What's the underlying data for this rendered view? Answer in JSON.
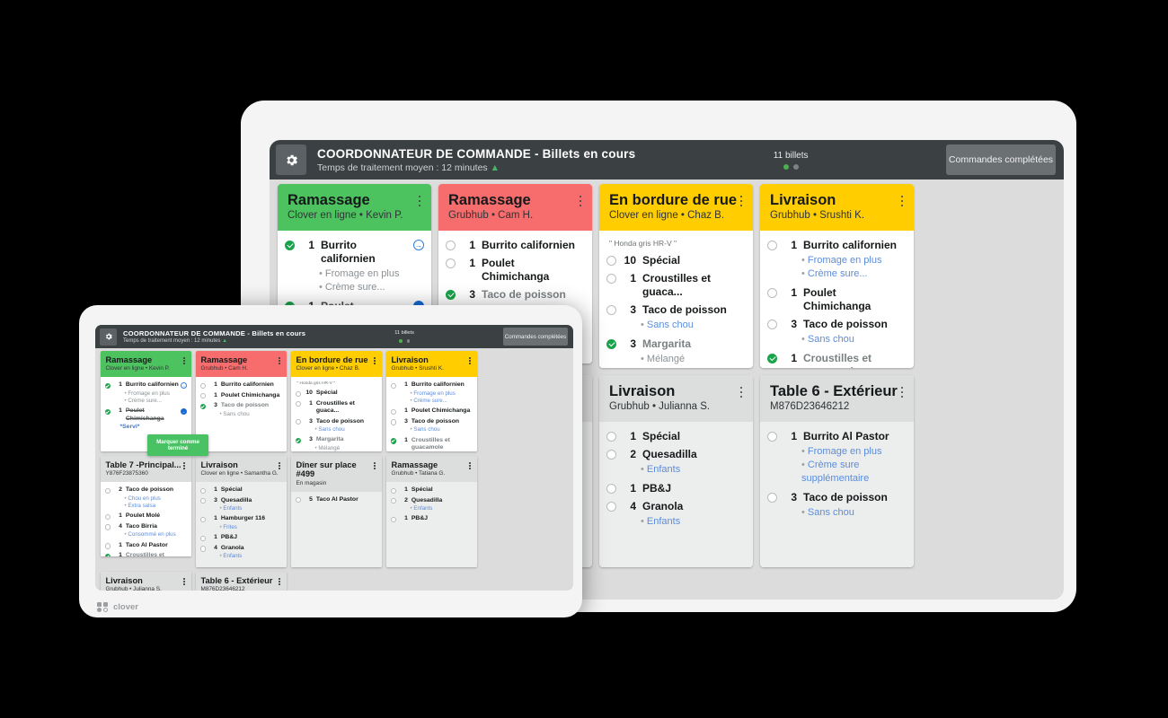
{
  "header": {
    "title": "COORDONNATEUR DE COMMANDE - Billets en cours",
    "subtitle": "Temps de traitement moyen : 12 minutes",
    "subtitle_arrow": "▲",
    "ticket_count": "11 billets",
    "completed_button": "Commandes complétées",
    "gear_icon": "gear-icon"
  },
  "brand": {
    "name": "clover"
  },
  "tooltip": {
    "text": "Marquer comme terminé"
  },
  "colors": {
    "green": "#4cc35f",
    "red": "#f76c6c",
    "yellow": "#ffcd00",
    "gray": "#dcdddd",
    "header_bg": "#3b4043",
    "accent_blue": "#5b8ddb",
    "done_green": "#1aa34a"
  },
  "tickets": [
    {
      "title": "Ramassage",
      "subtitle": "Clover en ligne •  Kevin P.",
      "color": "#4cc35f",
      "variant": "color",
      "note": "",
      "items": [
        {
          "done": true,
          "qty": "1",
          "name": "Burrito californien",
          "arrow": "outline",
          "mods": [
            {
              "text": "Fromage en plus",
              "blue": false
            },
            {
              "text": "Crème sure...",
              "blue": false
            }
          ]
        },
        {
          "done": true,
          "qty": "1",
          "name": "Poulet Chimichanga",
          "struck": true,
          "arrow": "filled",
          "served": "*Servi*",
          "mods": []
        }
      ]
    },
    {
      "title": "Ramassage",
      "subtitle": "Grubhub •  Cam H.",
      "color": "#f76c6c",
      "variant": "color",
      "note": "",
      "items": [
        {
          "done": false,
          "qty": "1",
          "name": "Burrito californien",
          "mods": []
        },
        {
          "done": false,
          "qty": "1",
          "name": "Poulet Chimichanga",
          "mods": []
        },
        {
          "done": true,
          "qty": "3",
          "name": "Taco de poisson",
          "muted": true,
          "mods": [
            {
              "text": "Sans chou",
              "blue": false
            }
          ]
        }
      ]
    },
    {
      "title": "En bordure de rue",
      "subtitle": "Clover en ligne •  Chaz B.",
      "color": "#ffcd00",
      "variant": "color",
      "note": "\" Honda gris HR-V \"",
      "items": [
        {
          "done": false,
          "qty": "10",
          "name": "Spécial",
          "mods": []
        },
        {
          "done": false,
          "qty": "1",
          "name": "Croustilles et guaca...",
          "mods": []
        },
        {
          "done": false,
          "qty": "3",
          "name": "Taco de poisson",
          "mods": [
            {
              "text": "Sans chou",
              "blue": true
            }
          ]
        },
        {
          "done": true,
          "qty": "3",
          "name": "Margarita",
          "muted": true,
          "mods": [
            {
              "text": "Mélangé",
              "blue": false
            }
          ]
        }
      ]
    },
    {
      "title": "Livraison",
      "subtitle": "Grubhub •  Srushti K.",
      "color": "#ffcd00",
      "variant": "color",
      "note": "",
      "items": [
        {
          "done": false,
          "qty": "1",
          "name": "Burrito californien",
          "mods": [
            {
              "text": "Fromage en plus",
              "blue": true
            },
            {
              "text": "Crème sure...",
              "blue": true
            }
          ]
        },
        {
          "done": false,
          "qty": "1",
          "name": "Poulet Chimichanga",
          "mods": []
        },
        {
          "done": false,
          "qty": "3",
          "name": "Taco de poisson",
          "mods": [
            {
              "text": "Sans chou",
              "blue": true
            }
          ]
        },
        {
          "done": true,
          "qty": "1",
          "name": "Croustilles et guacamole",
          "muted": true,
          "mods": []
        }
      ]
    },
    {
      "title": "Table 7 -Principal...",
      "subtitle": "Y876F23875360",
      "color": "#dcdddd",
      "variant": "gray-head",
      "note": "",
      "items": [
        {
          "done": false,
          "qty": "2",
          "name": "Taco de poisson",
          "mods": [
            {
              "text": "Chou en plus",
              "blue": true
            },
            {
              "text": "Extra salsa",
              "blue": true
            }
          ]
        },
        {
          "done": false,
          "qty": "1",
          "name": "Poulet Molé",
          "mods": []
        },
        {
          "done": false,
          "qty": "4",
          "name": "Taco Birria",
          "mods": [
            {
              "text": "Consommé en plus",
              "blue": true
            }
          ]
        },
        {
          "done": false,
          "qty": "1",
          "name": "Taco Al Pastor",
          "mods": []
        },
        {
          "done": true,
          "qty": "1",
          "name": "Croustilles et guacamole",
          "muted": true,
          "mods": []
        }
      ]
    },
    {
      "title": "Livraison",
      "subtitle": "Clover en ligne •  Samantha G.",
      "color": "#dcdddd",
      "variant": "gray",
      "note": "",
      "small_only": true,
      "items": [
        {
          "done": false,
          "qty": "1",
          "name": "Spécial",
          "mods": []
        },
        {
          "done": false,
          "qty": "3",
          "name": "Quesadilla",
          "mods": [
            {
              "text": "Enfants",
              "blue": true
            }
          ]
        },
        {
          "done": false,
          "qty": "1",
          "name": "Hamburger 116",
          "mods": [
            {
              "text": "Frites",
              "blue": true
            }
          ]
        },
        {
          "done": false,
          "qty": "1",
          "name": "PB&J",
          "mods": []
        },
        {
          "done": false,
          "qty": "4",
          "name": "Granola",
          "mods": [
            {
              "text": "Enfants",
              "blue": true
            }
          ]
        }
      ]
    },
    {
      "title": "Dîner sur place #499",
      "subtitle": "En magasin",
      "color": "#dcdddd",
      "variant": "gray",
      "note": "",
      "small_only": true,
      "items": [
        {
          "done": false,
          "qty": "5",
          "name": "Taco Al Pastor",
          "mods": []
        }
      ]
    },
    {
      "title": "Ramassage",
      "subtitle": "Grubhub •  Tatiana G.",
      "color": "#dcdddd",
      "variant": "gray",
      "note": "",
      "items": [
        {
          "done": false,
          "qty": "1",
          "name": "Spécial",
          "mods": []
        },
        {
          "done": false,
          "qty": "2",
          "name": "Quesadilla",
          "mods": [
            {
              "text": "Enfants",
              "blue": true
            }
          ]
        },
        {
          "done": false,
          "qty": "1",
          "name": "PB&J",
          "mods": []
        }
      ]
    },
    {
      "title": "Livraison",
      "subtitle": "Grubhub •  Julianna S.",
      "color": "#dcdddd",
      "variant": "gray",
      "note": "",
      "items": [
        {
          "done": false,
          "qty": "1",
          "name": "Spécial",
          "mods": []
        },
        {
          "done": false,
          "qty": "2",
          "name": "Quesadilla",
          "mods": [
            {
              "text": "Enfants",
              "blue": true
            }
          ]
        },
        {
          "done": false,
          "qty": "1",
          "name": "PB&J",
          "mods": []
        },
        {
          "done": false,
          "qty": "4",
          "name": "Granola",
          "mods": [
            {
              "text": "Enfants",
              "blue": true
            }
          ]
        }
      ]
    },
    {
      "title": "Table 6 - Extérieur",
      "subtitle": "M876D23646212",
      "color": "#dcdddd",
      "variant": "gray",
      "note": "",
      "items": [
        {
          "done": false,
          "qty": "1",
          "name": "Burrito Al Pastor",
          "mods": [
            {
              "text": "Fromage en plus",
              "blue": true
            },
            {
              "text": "Crème sure supplémentaire",
              "blue": true
            }
          ]
        },
        {
          "done": false,
          "qty": "3",
          "name": "Taco de poisson",
          "mods": [
            {
              "text": "Sans chou",
              "blue": true
            }
          ]
        }
      ]
    }
  ],
  "big_board_order": [
    0,
    1,
    2,
    3,
    4,
    7,
    8,
    9
  ],
  "small_board_order": [
    0,
    1,
    2,
    3,
    4,
    5,
    6,
    7,
    8,
    9
  ]
}
